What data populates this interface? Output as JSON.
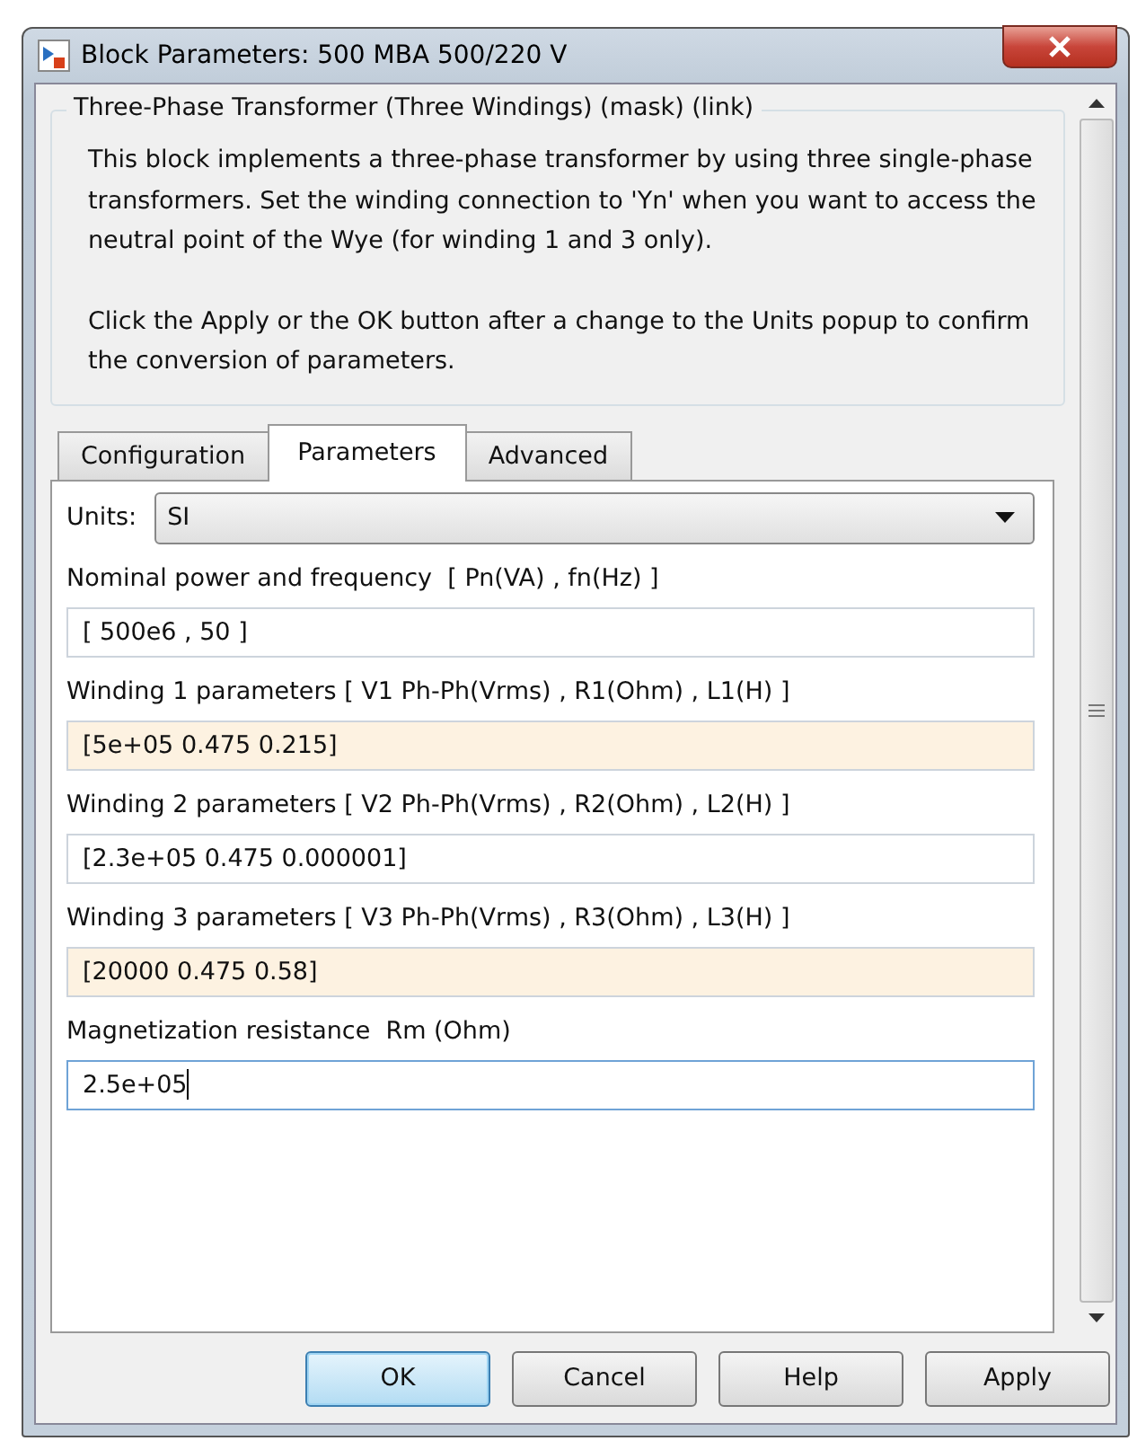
{
  "window": {
    "title": "Block Parameters: 500 MBA 500/220 V"
  },
  "description": {
    "title": "Three-Phase Transformer (Three Windings) (mask) (link)",
    "paragraphs": [
      "This block implements a three-phase transformer by using three single-phase transformers. Set the winding connection to 'Yn' when you want to access the neutral point of the Wye (for winding 1 and 3 only).",
      "Click the Apply or the OK button after a change to the Units popup to confirm the conversion of parameters."
    ]
  },
  "tabs": [
    {
      "label": "Configuration",
      "selected": false
    },
    {
      "label": "Parameters",
      "selected": true
    },
    {
      "label": "Advanced",
      "selected": false
    }
  ],
  "units": {
    "label": "Units:",
    "value": "SI"
  },
  "parameters": [
    {
      "label": "Nominal power and frequency  [ Pn(VA) , fn(Hz) ]",
      "value": "[ 500e6 , 50 ]",
      "highlighted": false,
      "focused": false
    },
    {
      "label": "Winding 1 parameters [ V1 Ph-Ph(Vrms) , R1(Ohm) , L1(H) ]",
      "value": "[5e+05 0.475 0.215]",
      "highlighted": true,
      "focused": false
    },
    {
      "label": "Winding 2 parameters [ V2 Ph-Ph(Vrms) , R2(Ohm) , L2(H) ]",
      "value": "[2.3e+05 0.475 0.000001]",
      "highlighted": false,
      "focused": false
    },
    {
      "label": "Winding 3 parameters [ V3 Ph-Ph(Vrms) , R3(Ohm) , L3(H) ]",
      "value": "[20000 0.475 0.58]",
      "highlighted": true,
      "focused": false
    },
    {
      "label": "Magnetization resistance  Rm (Ohm)",
      "value": "2.5e+05",
      "highlighted": false,
      "focused": true
    }
  ],
  "buttons": [
    {
      "label": "OK",
      "default": true
    },
    {
      "label": "Cancel",
      "default": false
    },
    {
      "label": "Help",
      "default": false
    },
    {
      "label": "Apply",
      "default": false
    }
  ]
}
